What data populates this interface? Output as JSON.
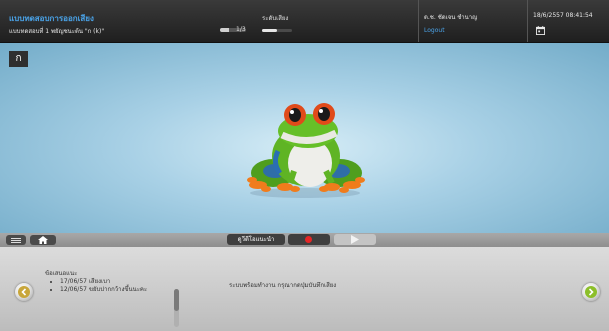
{
  "header": {
    "title": "แบบทดสอบการออกเสียง",
    "subtitle": "แบบทดสอบที่ 1 พยัญชนะต้น \"ก (k)\"",
    "progress_text": "1/3",
    "progress_fraction": 0.33,
    "volume_label": "ระดับเสียง",
    "volume_level": 0.5,
    "user_name": "ด.ช. ชัดเจน ชำนาญ",
    "logout_label": "Logout",
    "datetime": "18/6/2557 08:41:54",
    "calendar_icon": "calendar-icon"
  },
  "stage": {
    "letter": "ก",
    "image": "frog-illustration"
  },
  "toolbar": {
    "menu_icon": "menu-icon",
    "home_icon": "home-icon",
    "guide_label": "ดูวีดีโอแนะนำ",
    "record_icon": "record-icon",
    "play_icon": "play-icon"
  },
  "bottom": {
    "advice_title": "ข้อเสนอแนะ",
    "advice_items": [
      "17/06/57 เสียงเบา",
      "12/06/57 ขยับปากกว้างขึ้นนะคะ"
    ],
    "status_message": "ระบบพร้อมทำงาน กรุณากดปุ่มบันทึกเสียง",
    "prev_icon": "chevron-left-icon",
    "next_icon": "chevron-right-icon"
  },
  "colors": {
    "accent": "#4aa3e8",
    "record": "#e52626",
    "next": "#8cbf2a",
    "prev": "#c8a63a"
  }
}
